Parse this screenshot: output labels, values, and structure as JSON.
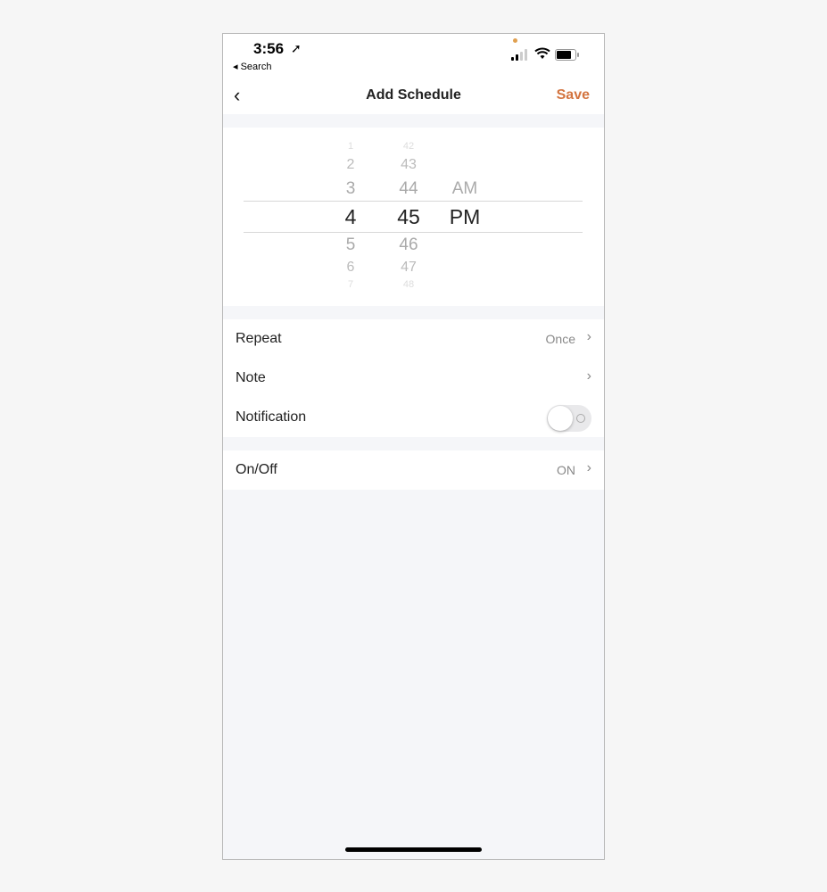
{
  "status_bar": {
    "time": "3:56",
    "back_app": "◂ Search"
  },
  "navbar": {
    "title": "Add Schedule",
    "save": "Save",
    "back_icon": "‹"
  },
  "picker": {
    "hours": [
      "1",
      "2",
      "3",
      "4",
      "5",
      "6",
      "7"
    ],
    "minutes": [
      "42",
      "43",
      "44",
      "45",
      "46",
      "47",
      "48"
    ],
    "periods": [
      "AM",
      "PM"
    ],
    "selected": {
      "hour": "4",
      "minute": "45",
      "period": "PM"
    }
  },
  "settings": {
    "repeat": {
      "label": "Repeat",
      "value": "Once"
    },
    "note": {
      "label": "Note"
    },
    "notification": {
      "label": "Notification",
      "enabled": false
    },
    "onoff": {
      "label": "On/Off",
      "value": "ON"
    }
  },
  "colors": {
    "accent": "#d3743f"
  }
}
